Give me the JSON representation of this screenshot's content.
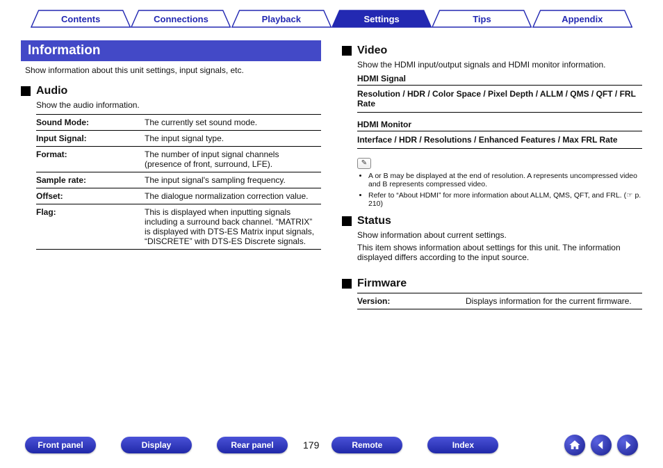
{
  "tabs": [
    "Contents",
    "Connections",
    "Playback",
    "Settings",
    "Tips",
    "Appendix"
  ],
  "active_tab_index": 3,
  "info_header": "Information",
  "intro": "Show information about this unit settings, input signals, etc.",
  "audio": {
    "title": "Audio",
    "desc": "Show the audio information.",
    "rows": [
      {
        "k": "Sound Mode:",
        "v": "The currently set sound mode."
      },
      {
        "k": "Input Signal:",
        "v": "The input signal type."
      },
      {
        "k": "Format:",
        "v": "The number of input signal channels (presence of front, surround, LFE)."
      },
      {
        "k": "Sample rate:",
        "v": "The input signal's sampling frequency."
      },
      {
        "k": "Offset:",
        "v": "The dialogue normalization correction value."
      },
      {
        "k": "Flag:",
        "v": "This is displayed when inputting signals including a surround back channel. “MATRIX” is displayed with DTS-ES Matrix input signals, “DISCRETE” with DTS-ES Discrete signals."
      }
    ]
  },
  "video": {
    "title": "Video",
    "desc": "Show the HDMI input/output signals and HDMI monitor information.",
    "hdmi_signal_label": "HDMI Signal",
    "hdmi_signal_items": "Resolution / HDR / Color Space / Pixel Depth / ALLM / QMS / QFT / FRL Rate",
    "hdmi_monitor_label": "HDMI Monitor",
    "hdmi_monitor_items": "Interface / HDR / Resolutions / Enhanced Features / Max FRL Rate",
    "notes": [
      "A or B may be displayed at the end of resolution. A represents uncompressed video and B represents compressed video.",
      "Refer to “About HDMI” for more information about ALLM, QMS, QFT, and FRL. (☞ p. 210)"
    ]
  },
  "status": {
    "title": "Status",
    "line1": "Show information about current settings.",
    "line2": "This item shows information about settings for this unit. The information displayed differs according to the input source."
  },
  "firmware": {
    "title": "Firmware",
    "rows": [
      {
        "k": "Version:",
        "v": "Displays information for the current firmware."
      }
    ]
  },
  "bottom_pills": [
    "Front panel",
    "Display",
    "Rear panel"
  ],
  "bottom_pills_right": [
    "Remote",
    "Index"
  ],
  "page_number": "179"
}
